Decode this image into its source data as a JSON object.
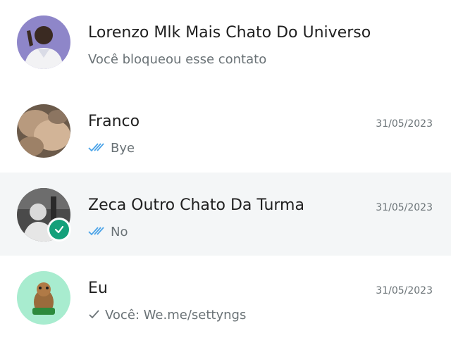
{
  "chats": [
    {
      "name": "Lorenzo Mlk Mais Chato Do Universo",
      "preview": "Você bloqueou esse contato",
      "date": "",
      "tick": "none",
      "avatar_icon": "person-avatar-icon"
    },
    {
      "name": "Franco",
      "preview": "Bye",
      "date": "31/05/2023",
      "tick": "double-read",
      "avatar_icon": "photo-avatar-icon"
    },
    {
      "name": "Zeca Outro Chato Da Turma",
      "preview": "No",
      "date": "31/05/2023",
      "tick": "double-read",
      "avatar_icon": "bw-photo-avatar-icon",
      "selected": true,
      "badge": "check-icon"
    },
    {
      "name": "Eu",
      "preview": "Você: We.me/settyngs",
      "date": "31/05/2023",
      "tick": "single-sent",
      "avatar_icon": "sticker-avatar-icon"
    }
  ],
  "colors": {
    "read_tick": "#4aa3e8",
    "sent_tick": "#6a7276",
    "badge": "#14a07a",
    "selected_row": "#f4f6f7"
  }
}
